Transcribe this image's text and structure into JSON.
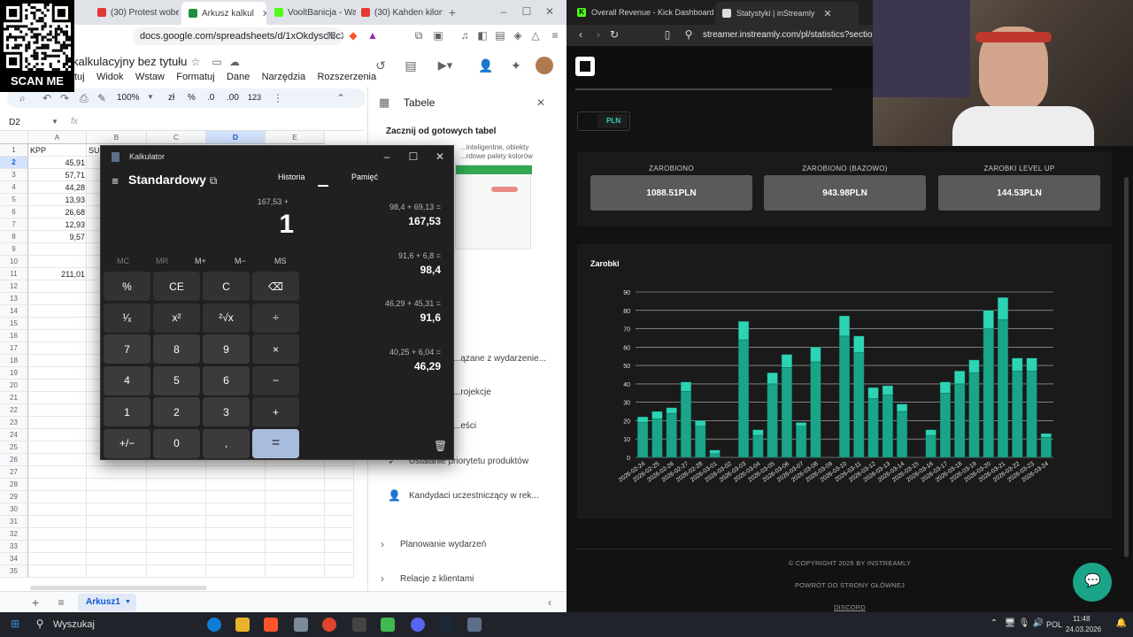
{
  "left_browser": {
    "tabs": [
      {
        "label": "(30) Protest wobec",
        "active": false
      },
      {
        "label": "Arkusz kalkul",
        "active": true
      },
      {
        "label": "VooltBanicja - Wa",
        "active": false
      },
      {
        "label": "(30) Kahden kilon",
        "active": false
      }
    ],
    "new_tab": "+",
    "url": "docs.google.com/spreadsheets/d/1xOkdyscl8cX..."
  },
  "sheets": {
    "doc_title": "kalkulacyjny bez tytułu",
    "menus": [
      "tuj",
      "Widok",
      "Wstaw",
      "Formatuj",
      "Dane",
      "Narzędzia",
      "Rozszerzenia"
    ],
    "zoom": "100%",
    "toolbar": {
      "currency": "zł",
      "percent": "%",
      "dec_less": ".0",
      "dec_more": ".00",
      "format": "123"
    },
    "name_box": "D2",
    "fx": "fx",
    "columns": [
      "A",
      "B",
      "C",
      "D",
      "E"
    ],
    "rows": [
      "1",
      "2",
      "3",
      "4",
      "5",
      "6",
      "7",
      "8",
      "9",
      "10",
      "11",
      "12",
      "13",
      "14",
      "15",
      "16",
      "17",
      "18",
      "19",
      "20",
      "21",
      "22",
      "23",
      "24",
      "25",
      "26",
      "27",
      "28",
      "29",
      "30",
      "31",
      "32",
      "33",
      "34",
      "35"
    ],
    "header_a": "KPP",
    "header_b": "SU",
    "values_a": [
      "45,91",
      "57,71",
      "44,28",
      "13,93",
      "26,68",
      "12,93",
      "9,57"
    ],
    "sum_a": "211,01",
    "sheet_tab": "Arkusz1",
    "add_sheet": "+"
  },
  "tables_panel": {
    "title": "Tabele",
    "subtitle": "Zacznij od gotowych tabel",
    "desc1": "...inteligentne, obiekty",
    "desc2": "...rdowe palety kolorów",
    "items": [
      "...ązane z wydarzenie...",
      "...rojekcje",
      "...eści",
      "Ustalanie priorytetu produktów",
      "Kandydaci uczestniczący w rek..."
    ],
    "sections": [
      "Planowanie wydarzeń",
      "Relacje z klientami"
    ]
  },
  "calculator": {
    "window_title": "Kalkulator",
    "mode": "Standardowy",
    "expression": "167,53 +",
    "display": "1",
    "tabs": {
      "history": "Historia",
      "memory": "Pamięć"
    },
    "memory_buttons": [
      "MC",
      "MR",
      "M+",
      "M−",
      "MS"
    ],
    "keys": [
      [
        "%",
        "CE",
        "C",
        "⌫"
      ],
      [
        "¹⁄ₓ",
        "x²",
        "²√x",
        "÷"
      ],
      [
        "7",
        "8",
        "9",
        "×"
      ],
      [
        "4",
        "5",
        "6",
        "−"
      ],
      [
        "1",
        "2",
        "3",
        "+"
      ],
      [
        "+/−",
        "0",
        ",",
        "="
      ]
    ],
    "history": [
      {
        "expr": "98,4  +  69,13 =",
        "result": "167,53"
      },
      {
        "expr": "91,6  +  6,8 =",
        "result": "98,4"
      },
      {
        "expr": "46,29  +  45,31 =",
        "result": "91,6"
      },
      {
        "expr": "40,25  +  6,04 =",
        "result": "46,29"
      }
    ]
  },
  "right_browser": {
    "tabs": [
      {
        "label": "Overall Revenue - Kick Dashboard",
        "active": false
      },
      {
        "label": "Statystyki | inStreamly",
        "active": true
      }
    ],
    "url": "streamer.instreamly.com/pl/statistics?section=..."
  },
  "instreamly": {
    "currency": "PLN",
    "stats": [
      {
        "label": "ZAROBIONO",
        "value": "1088.51PLN"
      },
      {
        "label": "ZAROBIONO (BAZOWO)",
        "value": "943.98PLN"
      },
      {
        "label": "ZAROBKI LEVEL UP",
        "value": "144.53PLN"
      }
    ],
    "chart_title": "Zarobki",
    "footer": [
      "© COPYRIGHT 2026 BY INSTREAMLY",
      "POWRÓT DO STRONY GŁÓWNEJ",
      "DISCORD"
    ]
  },
  "chart_data": {
    "type": "bar",
    "stacked": true,
    "title": "Zarobki",
    "xlabel": "",
    "ylabel": "",
    "ylim": [
      0,
      90
    ],
    "yticks": [
      0,
      10,
      20,
      30,
      40,
      50,
      60,
      70,
      80,
      90
    ],
    "grid": true,
    "categories": [
      "2026-02-24",
      "2026-02-25",
      "2026-02-26",
      "2026-02-27",
      "2026-02-28",
      "2026-03-01",
      "2026-03-02",
      "2026-03-03",
      "2026-03-04",
      "2026-03-05",
      "2026-03-06",
      "2026-03-07",
      "2026-03-08",
      "2026-03-09",
      "2026-03-10",
      "2026-03-11",
      "2026-03-12",
      "2026-03-13",
      "2026-03-14",
      "2026-03-15",
      "2026-03-16",
      "2026-03-17",
      "2026-03-18",
      "2026-03-19",
      "2026-03-20",
      "2026-03-21",
      "2026-03-22",
      "2026-03-23",
      "2026-03-24"
    ],
    "series": [
      {
        "values": [
          19,
          21,
          24,
          36,
          17,
          2,
          0,
          64,
          12,
          40,
          49,
          17,
          52,
          0,
          66,
          57,
          32,
          34,
          25,
          0,
          12,
          35,
          40,
          46,
          70,
          75,
          47,
          47,
          11
        ],
        "color": "#1aa589"
      },
      {
        "values": [
          3,
          4,
          3,
          5,
          3,
          2,
          0,
          10,
          3,
          6,
          7,
          2,
          8,
          0,
          11,
          9,
          6,
          5,
          4,
          0,
          3,
          6,
          7,
          7,
          10,
          12,
          7,
          7,
          2
        ],
        "color": "#2dd4b4"
      }
    ]
  },
  "taskbar": {
    "search": "Wyszukaj",
    "lang": "POL",
    "time": "11:48",
    "date": "24.03.2026"
  },
  "overlay": {
    "scan_me": "SCAN ME"
  }
}
